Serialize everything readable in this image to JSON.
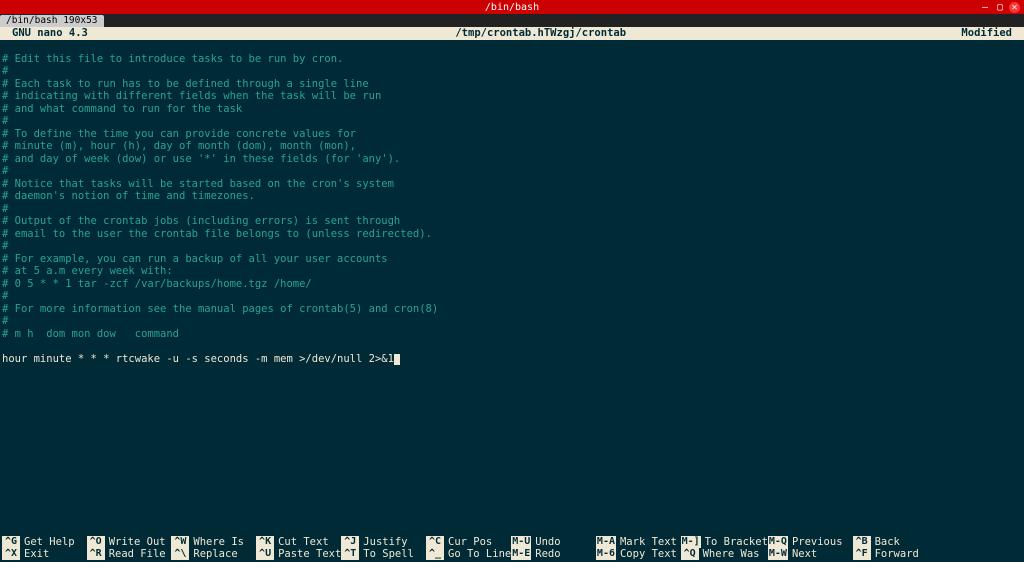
{
  "window": {
    "title": "/bin/bash",
    "tab_label": "/bin/bash 190x53"
  },
  "nano": {
    "app": "GNU nano 4.3",
    "filename": "/tmp/crontab.hTWzgj/crontab",
    "status": "Modified"
  },
  "content": {
    "lines": [
      "# Edit this file to introduce tasks to be run by cron.",
      "#",
      "# Each task to run has to be defined through a single line",
      "# indicating with different fields when the task will be run",
      "# and what command to run for the task",
      "#",
      "# To define the time you can provide concrete values for",
      "# minute (m), hour (h), day of month (dom), month (mon),",
      "# and day of week (dow) or use '*' in these fields (for 'any').",
      "#",
      "# Notice that tasks will be started based on the cron's system",
      "# daemon's notion of time and timezones.",
      "#",
      "# Output of the crontab jobs (including errors) is sent through",
      "# email to the user the crontab file belongs to (unless redirected).",
      "#",
      "# For example, you can run a backup of all your user accounts",
      "# at 5 a.m every week with:",
      "# 0 5 * * 1 tar -zcf /var/backups/home.tgz /home/",
      "#",
      "# For more information see the manual pages of crontab(5) and cron(8)",
      "#",
      "# m h  dom mon dow   command"
    ],
    "user_line": "hour minute * * * rtcwake -u -s seconds -m mem >/dev/null 2>&1"
  },
  "shortcuts": [
    {
      "key": "^G",
      "label": "Get Help"
    },
    {
      "key": "^X",
      "label": "Exit"
    },
    {
      "key": "^O",
      "label": "Write Out"
    },
    {
      "key": "^R",
      "label": "Read File"
    },
    {
      "key": "^W",
      "label": "Where Is"
    },
    {
      "key": "^\\",
      "label": "Replace"
    },
    {
      "key": "^K",
      "label": "Cut Text"
    },
    {
      "key": "^U",
      "label": "Paste Text"
    },
    {
      "key": "^J",
      "label": "Justify"
    },
    {
      "key": "^T",
      "label": "To Spell"
    },
    {
      "key": "^C",
      "label": "Cur Pos"
    },
    {
      "key": "^_",
      "label": "Go To Line"
    },
    {
      "key": "M-U",
      "label": "Undo"
    },
    {
      "key": "M-E",
      "label": "Redo"
    },
    {
      "key": "M-A",
      "label": "Mark Text"
    },
    {
      "key": "M-6",
      "label": "Copy Text"
    },
    {
      "key": "M-]",
      "label": "To Bracket"
    },
    {
      "key": "^Q",
      "label": "Where Was"
    },
    {
      "key": "M-Q",
      "label": "Previous"
    },
    {
      "key": "M-W",
      "label": "Next"
    },
    {
      "key": "^B",
      "label": "Back"
    },
    {
      "key": "^F",
      "label": "Forward"
    }
  ]
}
